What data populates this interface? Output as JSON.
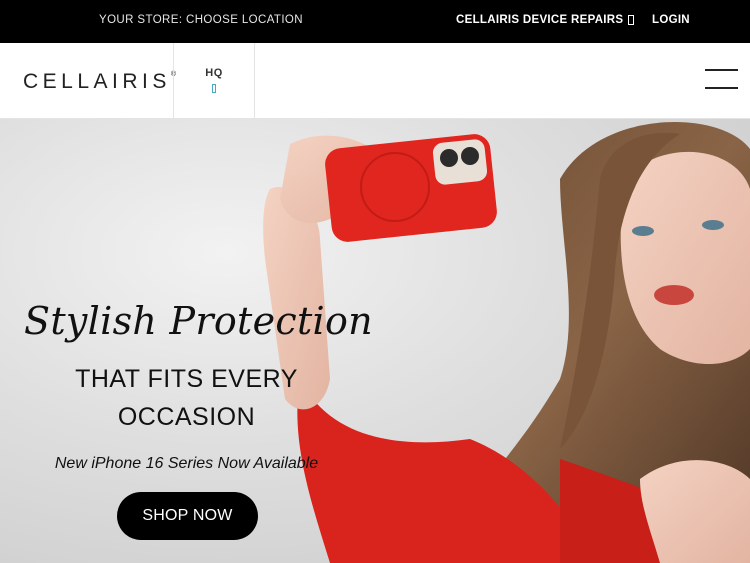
{
  "topbar": {
    "store_label": "YOUR STORE: CHOOSE LOCATION",
    "repairs_label": "CELLAIRIS DEVICE REPAIRS",
    "repairs_icon": "external-link-icon",
    "login_label": "LOGIN"
  },
  "header": {
    "logo_text": "CELLAIRIS",
    "logo_mark": "®",
    "location_label": "HQ",
    "location_icon": "map-pin-icon",
    "menu_icon": "hamburger-menu-icon"
  },
  "hero": {
    "headline": "Stylish Protection",
    "subline_1": "THAT FITS EVERY",
    "subline_2": "OCCASION",
    "tagline": "New iPhone 16 Series Now Available",
    "cta_label": "SHOP NOW"
  },
  "colors": {
    "topbar_bg": "#000000",
    "phone_case": "#e0261e",
    "accent_icon": "#4aa8c4",
    "cta_bg": "#000000"
  }
}
